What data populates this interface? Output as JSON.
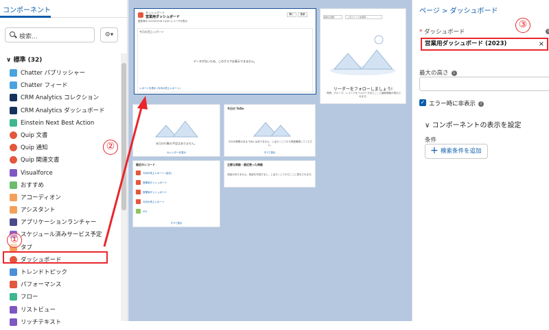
{
  "left_panel": {
    "tab_label": "コンポーネント",
    "search_placeholder": "検索...",
    "section_label": "標準 (32)",
    "items": [
      {
        "label": "Chatter パブリッシャー",
        "color": "#4aa3df"
      },
      {
        "label": "Chatter フィード",
        "color": "#4aa3df"
      },
      {
        "label": "CRM Analytics コレクション",
        "color": "#16325c"
      },
      {
        "label": "CRM Analytics ダッシュボード",
        "color": "#16325c"
      },
      {
        "label": "Einstein Next Best Action",
        "color": "#3fb68e"
      },
      {
        "label": "Quip 文書",
        "color": "#e3573c"
      },
      {
        "label": "Quip 通知",
        "color": "#e3573c"
      },
      {
        "label": "Quip 関連文書",
        "color": "#e3573c"
      },
      {
        "label": "Visualforce",
        "color": "#7e57c2"
      },
      {
        "label": "おすすめ",
        "color": "#6bbd6b"
      },
      {
        "label": "アコーディオン",
        "color": "#f4a05a"
      },
      {
        "label": "アシスタント",
        "color": "#f4a05a"
      },
      {
        "label": "アプリケーションランチャー",
        "color": "#4a4a8a"
      },
      {
        "label": "スケジュール済みサービス予定",
        "color": "#8a63d2"
      },
      {
        "label": "タブ",
        "color": "#f4a05a"
      },
      {
        "label": "ダッシュボード",
        "color": "#e3573c"
      },
      {
        "label": "トレンドトピック",
        "color": "#4a90d9"
      },
      {
        "label": "パフォーマンス",
        "color": "#e3573c"
      },
      {
        "label": "フロー",
        "color": "#3fb68e"
      },
      {
        "label": "リストビュー",
        "color": "#7e57c2"
      },
      {
        "label": "リッチテキスト",
        "color": "#7e57c2"
      }
    ]
  },
  "annotations": {
    "one": "①",
    "two": "②",
    "three": "③"
  },
  "canvas": {
    "dash_small": "ダッシュボード",
    "dash_title": "営業用ダッシュボード",
    "dash_sub": "更新済み 2023/03/16 14:00 にユーザが表示",
    "dash_btn1": "開く",
    "dash_btn2": "更新",
    "dash_chart_title": "今月の売上レポート",
    "dash_chart_msg": "データがないため、このグラフは表示できません。",
    "dash_footer": "レポートを表示 (今月の売上レポート)",
    "follow_msg": "リーダーをフォローしましょう!",
    "follow_sub": "同僚、グループ、レコードをフォローするとここに最新情報が表示されます。",
    "follow_search": "このフィードを検索...",
    "follow_select": "最新の活動",
    "c1_msg": "本日の行動の予定はありません。",
    "c1_link": "カレンダーを表示",
    "todo_title": "今日の ToDo",
    "todo_msg": "今日の期限のある ToDo はありません。しばらくしてから再度確認してください。",
    "todo_link": "すべて表示",
    "recent_title": "最近のレコード",
    "recent_items": [
      "今月の売上レポート (会社)",
      "営業用ダッシュボード",
      "営業用ダッシュボード",
      "今月の売上レポート",
      "201"
    ],
    "recent_link": "すべて表示",
    "deals_title": "主要な商談・最近使った商談",
    "deals_msg": "商談がありません。商談を作成すると、しばらくしてからここに表示されます。"
  },
  "right_panel": {
    "breadcrumb": "ページ > ダッシュボード",
    "dashboard_label": "ダッシュボード",
    "dashboard_value": "営業用ダッシュボード (2023)",
    "clear_icon": "×",
    "height_label": "最大の高さ",
    "hide_on_error_label": "エラー時に非表示",
    "section_label": "コンポーネントの表示を設定",
    "condition_label": "条件",
    "add_condition_button": "検索条件を追加"
  }
}
